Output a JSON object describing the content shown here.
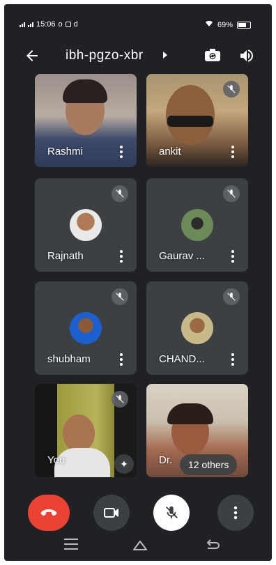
{
  "status_bar": {
    "time": "15:06",
    "extra_icons": "o",
    "battery_percent": "69%"
  },
  "header": {
    "meeting_code": "ibh-pgzo-xbr"
  },
  "participants": [
    {
      "name": "Rashmi",
      "muted": false,
      "video": true
    },
    {
      "name": "ankit",
      "muted": true,
      "video": true
    },
    {
      "name": "Rajnath",
      "muted": true,
      "video": false
    },
    {
      "name": "Gaurav ...",
      "muted": true,
      "video": false
    },
    {
      "name": "shubham",
      "muted": true,
      "video": false
    },
    {
      "name": "CHAND...",
      "muted": true,
      "video": false
    },
    {
      "name": "You",
      "muted": true,
      "video": true
    },
    {
      "name": "Dr.",
      "muted": false,
      "video": true
    }
  ],
  "others_chip": "12 others",
  "colors": {
    "background": "#202124",
    "tile": "#3c4043",
    "end_call": "#ea4335"
  }
}
